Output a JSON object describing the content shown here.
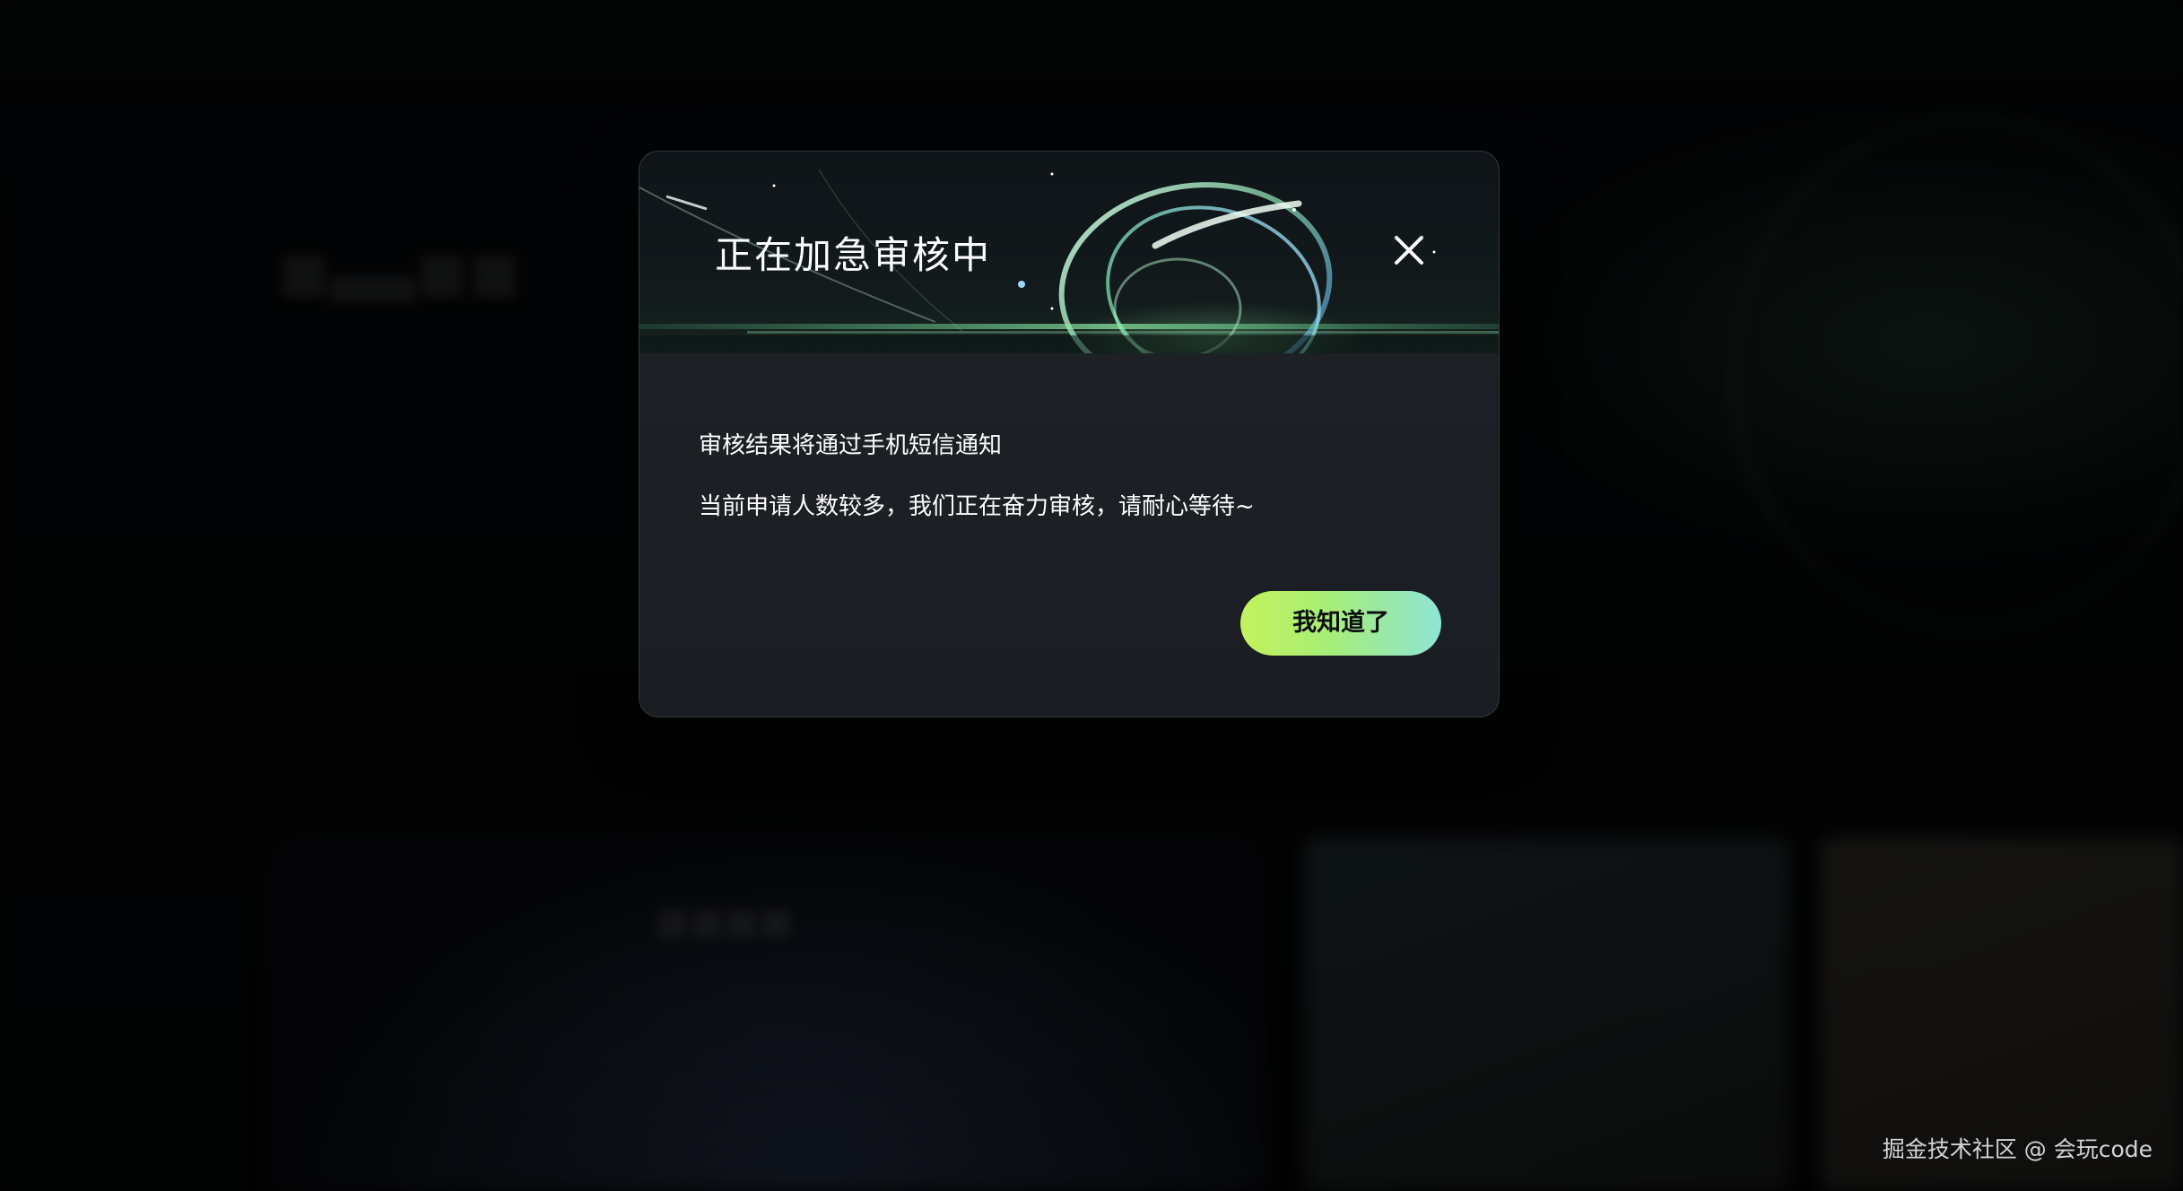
{
  "dialog": {
    "title": "正在加急审核中",
    "close_icon": "close-icon",
    "message_line_1": "审核结果将通过手机短信通知",
    "message_line_2": "当前申请人数较多，我们正在奋力审核，请耐心等待~",
    "confirm_label": "我知道了"
  },
  "watermark": "掘金技术社区 @ 会玩code",
  "colors": {
    "dialog_bg": "#1f2329",
    "button_gradient_start": "#c4f25c",
    "button_gradient_end": "#8ee4d6",
    "title_text": "#ffffff"
  }
}
